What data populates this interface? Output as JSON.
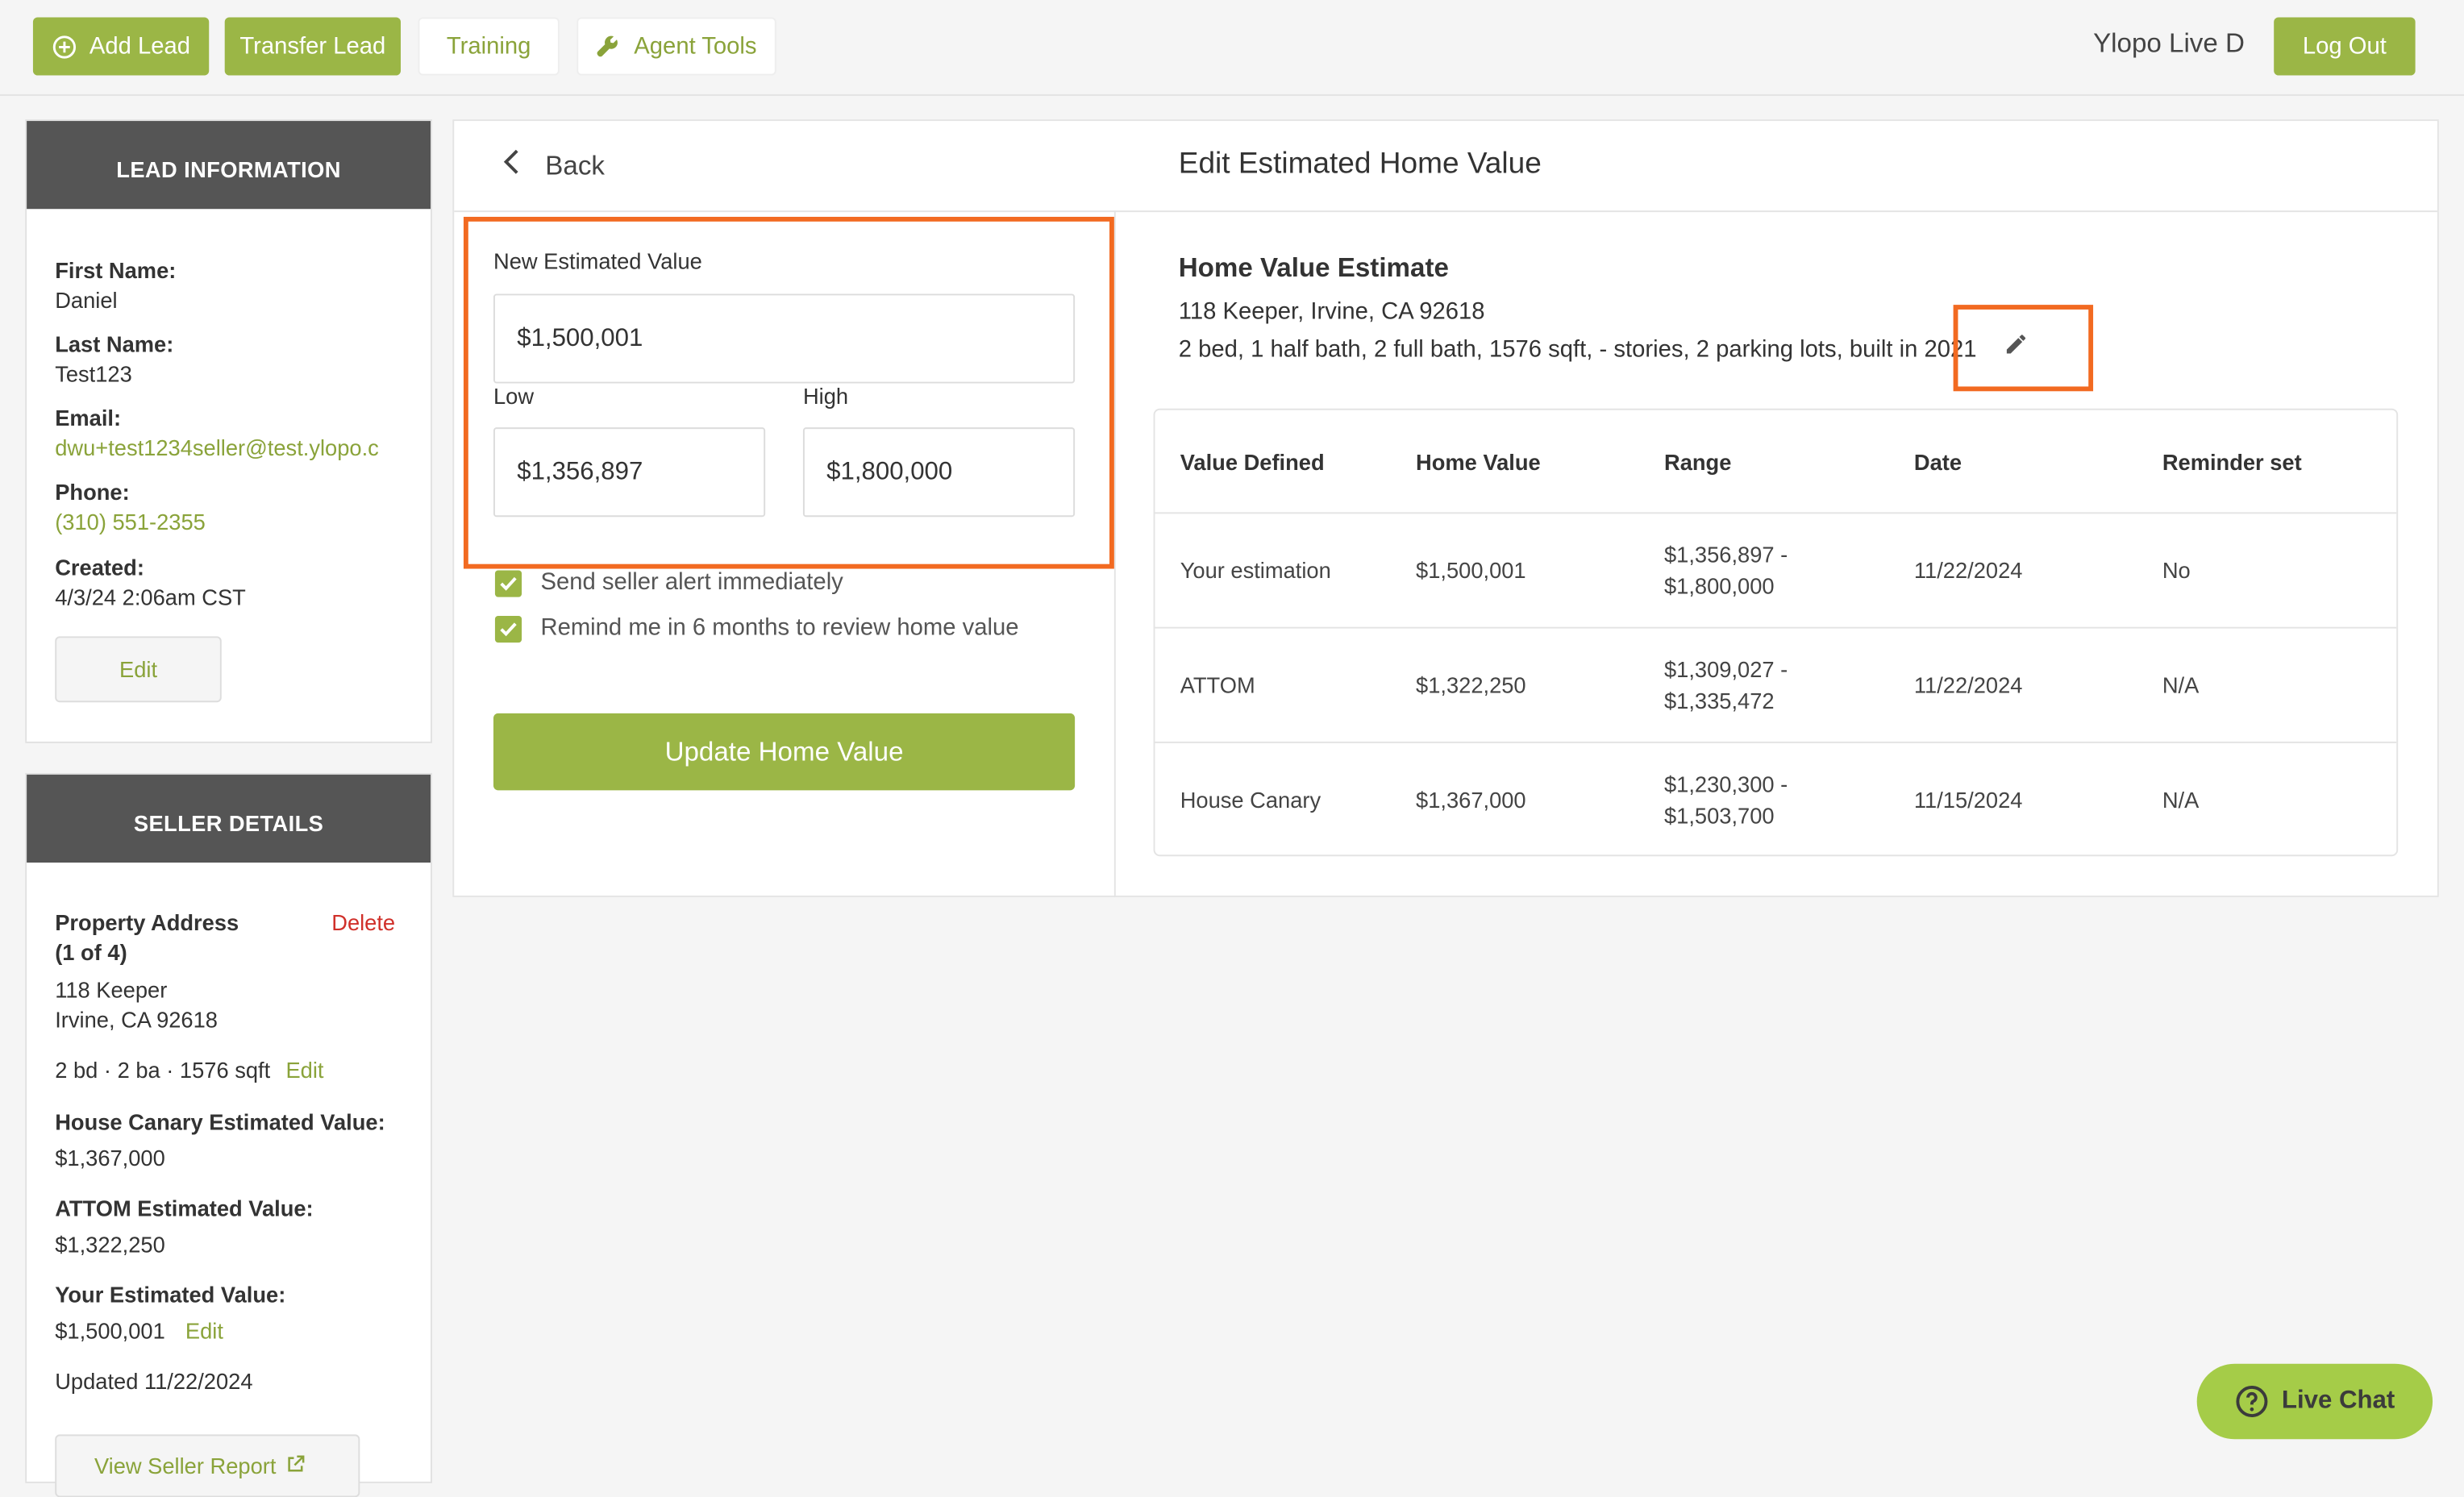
{
  "toolbar": {
    "add_lead": "Add Lead",
    "transfer_lead": "Transfer Lead",
    "training": "Training",
    "agent_tools": "Agent Tools",
    "user_name": "Ylopo Live D",
    "log_out": "Log Out"
  },
  "lead_info": {
    "header": "LEAD INFORMATION",
    "first_name_label": "First Name:",
    "first_name": "Daniel",
    "last_name_label": "Last Name:",
    "last_name": "Test123",
    "email_label": "Email:",
    "email": "dwu+test1234seller@test.ylopo.c",
    "phone_label": "Phone:",
    "phone": "(310) 551-2355",
    "created_label": "Created:",
    "created": "4/3/24 2:06am CST",
    "edit": "Edit"
  },
  "seller_details": {
    "header": "SELLER DETAILS",
    "property_label": "Property Address",
    "property_count": "(1 of 4)",
    "delete": "Delete",
    "address_line1": "118 Keeper",
    "address_line2": "Irvine, CA 92618",
    "specs": "2 bd · 2 ba · 1576 sqft",
    "specs_edit": "Edit",
    "hc_label": "House Canary Estimated Value:",
    "hc_value": "$1,367,000",
    "attom_label": "ATTOM Estimated Value:",
    "attom_value": "$1,322,250",
    "your_label": "Your Estimated Value:",
    "your_value": "$1,500,001",
    "your_edit": "Edit",
    "updated": "Updated 11/22/2024",
    "view_report": "View Seller Report"
  },
  "edit_form": {
    "back": "Back",
    "title": "Edit Estimated Home Value",
    "new_value_label": "New Estimated Value",
    "new_value": "$1,500,001",
    "low_label": "Low",
    "low_value": "$1,356,897",
    "high_label": "High",
    "high_value": "$1,800,000",
    "alert_label": "Send seller alert immediately",
    "remind_label": "Remind me in 6 months to review home value",
    "update_button": "Update Home Value"
  },
  "estimate": {
    "title": "Home Value Estimate",
    "address": "118 Keeper, Irvine, CA 92618",
    "details": "2 bed, 1 half bath, 2 full bath, 1576 sqft, - stories, 2 parking lots, built in 2021",
    "columns": [
      "Value Defined",
      "Home Value",
      "Range",
      "Date",
      "Reminder set"
    ],
    "rows": [
      {
        "source": "Your estimation",
        "value": "$1,500,001",
        "range_low": "$1,356,897 -",
        "range_high": "$1,800,000",
        "date": "11/22/2024",
        "reminder": "No"
      },
      {
        "source": "ATTOM",
        "value": "$1,322,250",
        "range_low": "$1,309,027 -",
        "range_high": "$1,335,472",
        "date": "11/22/2024",
        "reminder": "N/A"
      },
      {
        "source": "House Canary",
        "value": "$1,367,000",
        "range_low": "$1,230,300 -",
        "range_high": "$1,503,700",
        "date": "11/15/2024",
        "reminder": "N/A"
      }
    ]
  },
  "live_chat": "Live Chat",
  "colors": {
    "brand_green": "#9bb646",
    "link_green": "#8aa33a",
    "highlight_orange": "#f26a21",
    "header_gray": "#555555",
    "delete_red": "#d0302a"
  }
}
